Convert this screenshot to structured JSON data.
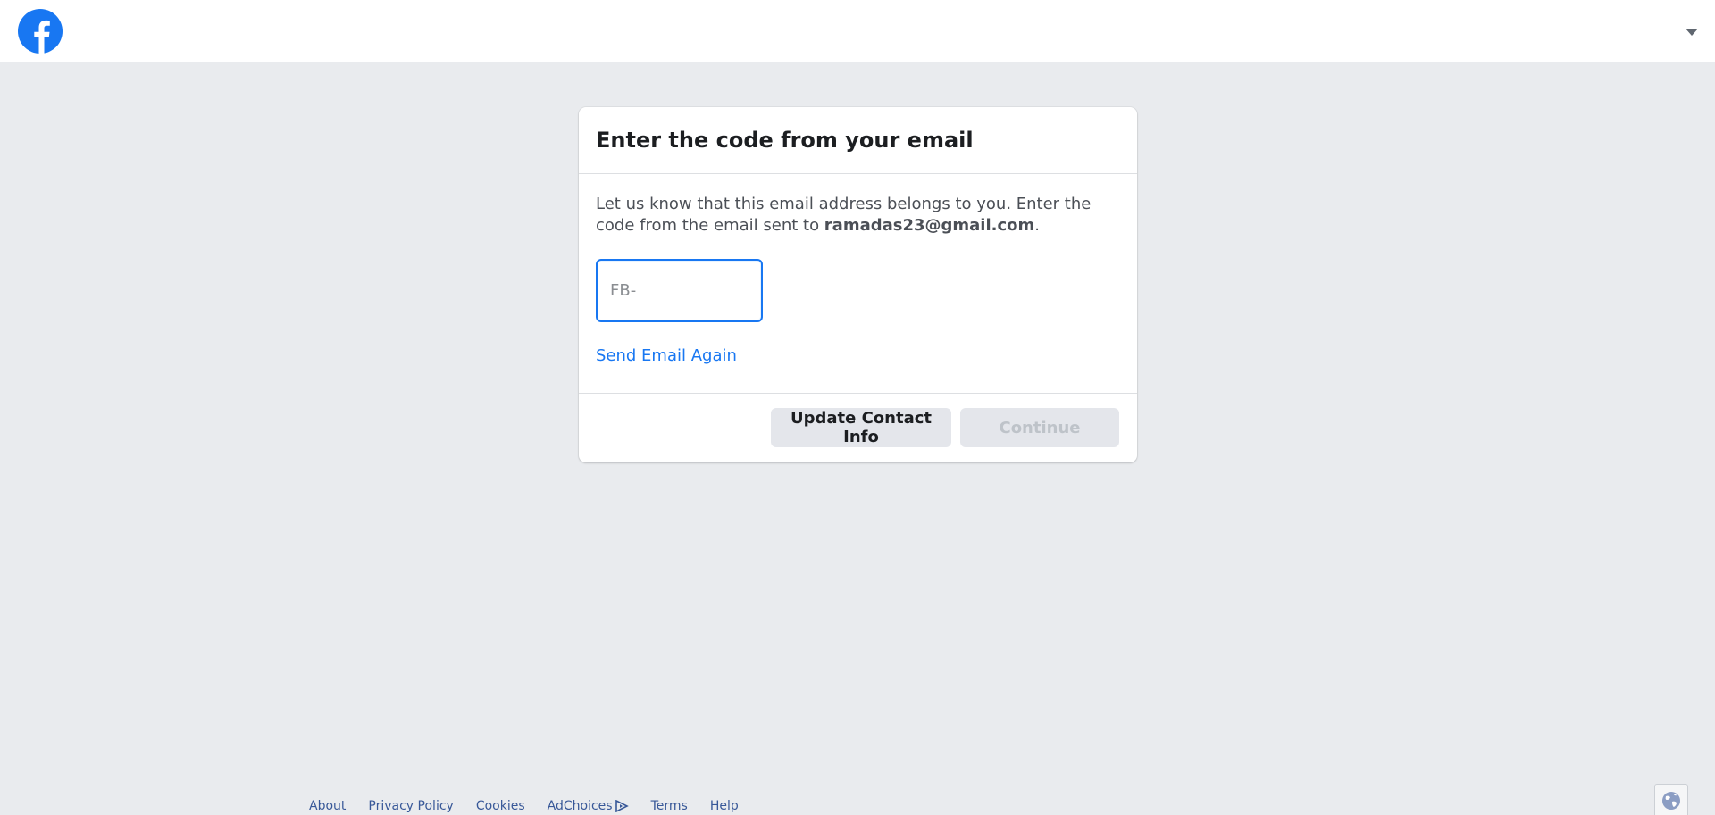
{
  "colors": {
    "brand_blue": "#1877f2",
    "page_background": "#e9ebee",
    "link_blue": "#385898"
  },
  "header": {
    "logo_icon": "facebook-logo-icon",
    "menu_icon": "caret-down-icon"
  },
  "dialog": {
    "title": "Enter the code from your email",
    "description_prefix": "Let us know that this email address belongs to you. Enter the code from the email sent to ",
    "email": "ramadas23@gmail.com",
    "description_suffix": ".",
    "code_input": {
      "value": "",
      "placeholder": "FB-"
    },
    "resend_link": "Send Email Again",
    "buttons": {
      "update": "Update Contact Info",
      "continue": "Continue"
    }
  },
  "footer": {
    "links": {
      "about": "About",
      "privacy": "Privacy Policy",
      "cookies": "Cookies",
      "adchoices": "AdChoices",
      "terms": "Terms",
      "help": "Help"
    },
    "language_icon": "globe-icon"
  }
}
